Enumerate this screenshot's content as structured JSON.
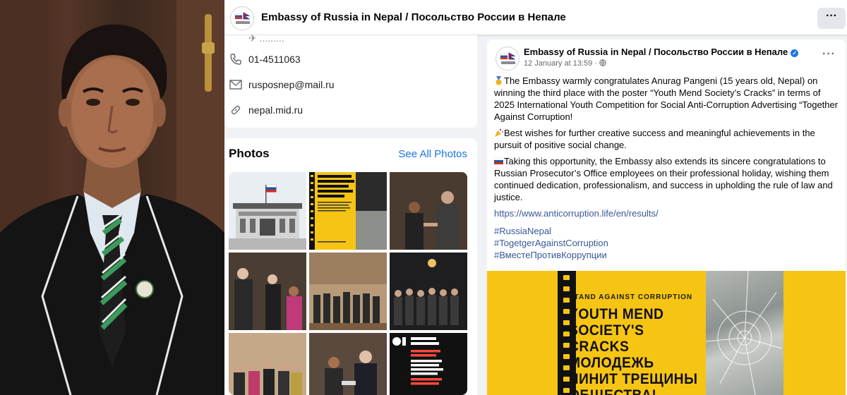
{
  "page": {
    "title": "Embassy of Russia in Nepal / Посольство России в Непале",
    "more_label": "···"
  },
  "intro": {
    "cut_text": "✈ .........",
    "phone": "01-4511063",
    "email": "rusposnep@mail.ru",
    "website": "nepal.mid.ru",
    "icons": [
      "phone-icon",
      "mail-icon",
      "link-icon"
    ]
  },
  "photos": {
    "title": "Photos",
    "see_all": "See All Photos",
    "tiles": [
      {
        "name": "embassy-building"
      },
      {
        "name": "youth-mend-poster",
        "text": "YOUTH MEND SOCIETY'S CRACKS МОЛОДЕЖЬ ЧИНИТ ТРЕЩИНЫ ОБЩЕСТВА!"
      },
      {
        "name": "handshake-event"
      },
      {
        "name": "reception-guests"
      },
      {
        "name": "hall-gathering"
      },
      {
        "name": "group-photo-evening"
      },
      {
        "name": "group-photo-indoor"
      },
      {
        "name": "ceremony-award"
      },
      {
        "name": "open-dialogue-poster",
        "text": "OPEN DIALOGUE 7 OCTOBER – 26 DECEMBER WRITE AN ESSAY AND BECOME A PARTICIPANT! YOUR PERSPECTIVE MATTERS!"
      }
    ]
  },
  "post": {
    "author": "Embassy of Russia in Nepal / Посольство России в Непале",
    "date": "12 January at 13:59 ·",
    "more_label": "···",
    "p1": "The Embassy warmly congratulates Anurag Pangeni (15 years old, Nepal) on winning the third place with the poster “Youth Mend Society’s Cracks” in terms of 2025 International Youth Competition for Social Anti-Corruption Advertising “Together Against Corruption!",
    "p2": "Best wishes for further creative success and meaningful achievements in the pursuit of positive social change.",
    "p3": "Taking this opportunity, the Embassy also extends its sincere congratulations to Russian Prosecutor’s Office employees on their professional holiday, wishing them continued dedication, professionalism, and success in upholding the rule of law and justice.",
    "link": "https://www.anticorruption.life/en/results/",
    "hashtags": [
      "#RussiaNepal",
      "#TogetgerAgainstCorruption",
      "#ВместеПротивКоррупции"
    ]
  },
  "poster": {
    "subtitle": "STAND AGAINST CORRUPTION",
    "headline": "YOUTH MEND SOCIETY'S CRACKS МОЛОДЕЖЬ ЧИНИТ ТРЕЩИНЫ ОБЩЕСТВА!"
  },
  "colors": {
    "accent": "#1b74e4",
    "link": "#385898",
    "poster_yellow": "#f6c514",
    "background": "#f0f2f5"
  }
}
